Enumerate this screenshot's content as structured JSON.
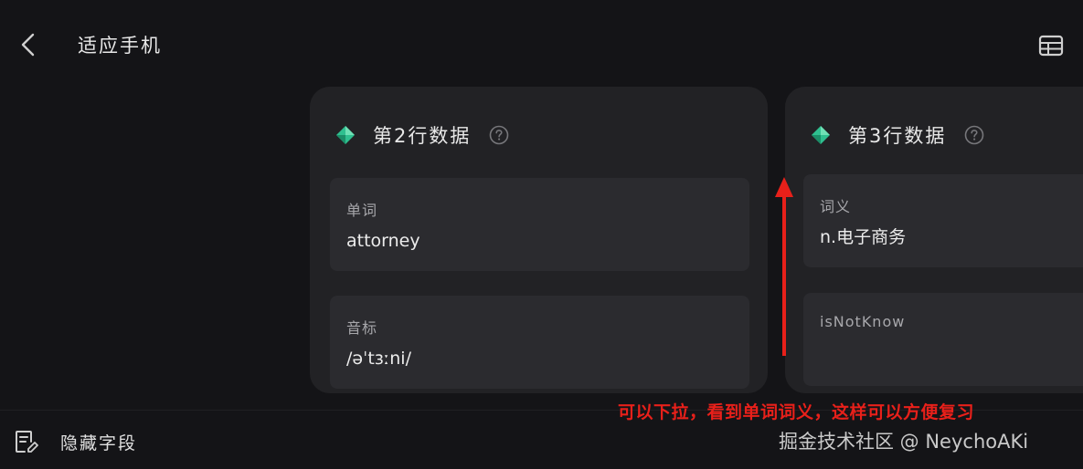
{
  "header": {
    "back_icon": "chevron-left-icon",
    "title": "适应手机",
    "table_icon": "table-grid-icon"
  },
  "cards": [
    {
      "title": "第2行数据",
      "icon": "diamond-logo-icon",
      "help_icon": "question-circle-icon",
      "fields": [
        {
          "label": "单词",
          "value": "attorney"
        },
        {
          "label": "音标",
          "value": "/əˈtɜːni/"
        }
      ]
    },
    {
      "title": "第3行数据",
      "icon": "diamond-logo-icon",
      "help_icon": "question-circle-icon",
      "fields": [
        {
          "label": "词义",
          "value": "n.电子商务"
        },
        {
          "label": "isNotKnow",
          "value": ""
        }
      ]
    }
  ],
  "footer": {
    "hide_fields_icon": "document-edit-icon",
    "hide_fields_label": "隐藏字段"
  },
  "annotation": {
    "text": "可以下拉，看到单词词义，这样可以方便复习",
    "color": "#e8201a",
    "arrow": "up-arrow"
  },
  "watermark": {
    "text": "掘金技术社区 @ NeychoAKi"
  },
  "colors": {
    "background": "#141417",
    "card": "#222225",
    "field": "#2b2b2f",
    "accent_green": "#2fbf8f"
  }
}
